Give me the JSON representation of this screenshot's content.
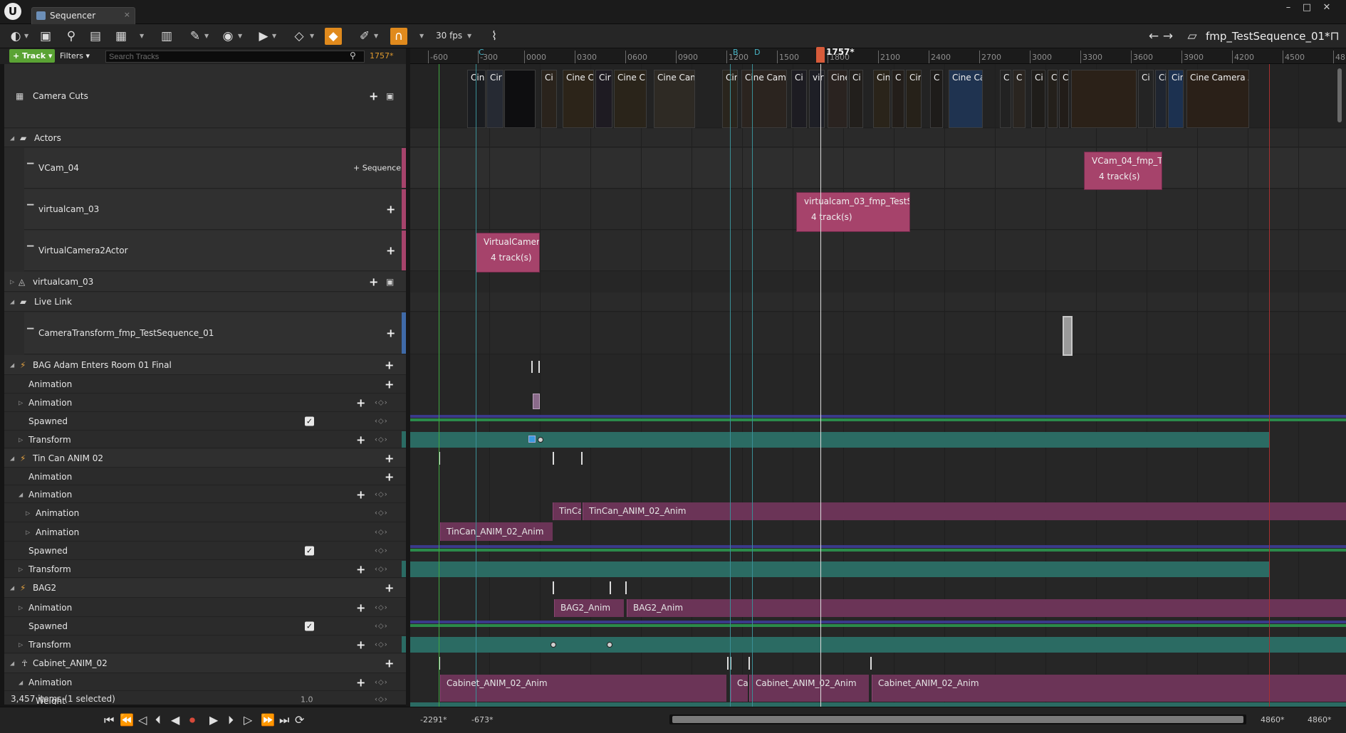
{
  "tab": {
    "title": "Sequencer",
    "close": "×"
  },
  "window_controls": {
    "minimize": "–",
    "maximize": "□",
    "close": "✕"
  },
  "toolbar": {
    "fps": "30 fps",
    "sequence_name": "fmp_TestSequence_01*",
    "nav_back": "←",
    "nav_forward": "→"
  },
  "outliner_header": {
    "track_button": "+ Track ▾",
    "filters_button": "Filters ▾",
    "search_placeholder": "Search Tracks",
    "current_frame": "1757*"
  },
  "tracks": [
    {
      "label": "Camera Cuts"
    },
    {
      "label": "Actors"
    },
    {
      "label": "VCam_04",
      "action": "Sequence"
    },
    {
      "label": "virtualcam_03"
    },
    {
      "label": "VirtualCamera2Actor"
    },
    {
      "label": "virtualcam_03"
    },
    {
      "label": "Live Link"
    },
    {
      "label": "CameraTransform_fmp_TestSequence_01"
    },
    {
      "label": "BAG Adam Enters Room 01 Final"
    },
    {
      "label": "Animation"
    },
    {
      "label": "Animation"
    },
    {
      "label": "Spawned"
    },
    {
      "label": "Transform"
    },
    {
      "label": "Tin Can ANIM 02"
    },
    {
      "label": "Animation"
    },
    {
      "label": "Animation"
    },
    {
      "label": "Animation"
    },
    {
      "label": "Animation"
    },
    {
      "label": "Spawned"
    },
    {
      "label": "Transform"
    },
    {
      "label": "BAG2"
    },
    {
      "label": "Animation"
    },
    {
      "label": "Spawned"
    },
    {
      "label": "Transform"
    },
    {
      "label": "Cabinet_ANIM_02"
    },
    {
      "label": "Animation"
    },
    {
      "label": "Weight",
      "value": "1.0"
    }
  ],
  "status": {
    "items": "3,457 items (1 selected)"
  },
  "ruler": {
    "ticks": [
      "-600",
      "-300",
      "0000",
      "0300",
      "0600",
      "0900",
      "1200",
      "1500",
      "1800",
      "2100",
      "2400",
      "2700",
      "3000",
      "3300",
      "3600",
      "3900",
      "4200",
      "4500",
      "48"
    ],
    "playhead": "1757*",
    "markers": [
      "C",
      "B",
      "D"
    ]
  },
  "camera_cuts": [
    "Cin",
    "Cir",
    "",
    "Ci",
    "Cine C",
    "Cir",
    "Cine C",
    "Cine Came",
    "Cin",
    "Cine Came",
    "Ci",
    "virt",
    "Cine",
    "Ci",
    "Cin",
    "C",
    "Cir",
    "C",
    "Cine Ca",
    "C",
    "C",
    "Ci",
    "C",
    "C",
    "",
    "Ci",
    "Ci",
    "Cin",
    "Cine Camera A"
  ],
  "sections": {
    "vcam04": {
      "title": "VCam_04_fmp_Te",
      "sub": "4 track(s)"
    },
    "virtualcam03": {
      "title": "virtualcam_03_fmp_TestSec",
      "sub": "4 track(s)"
    },
    "vcam2": {
      "title": "VirtualCamera",
      "sub": "4 track(s)"
    }
  },
  "anims": {
    "tincan_a": "TinCa",
    "tincan_b": "TinCan_ANIM_02_Anim",
    "tincan_c": "TinCan_ANIM_02_Anim",
    "bag2_a": "BAG2_Anim",
    "bag2_b": "BAG2_Anim",
    "cab_a": "Cabinet_ANIM_02_Anim",
    "cab_b": "Cab",
    "cab_c": "Cabinet_ANIM_02_Anim",
    "cab_d": "Cabinet_ANIM_02_Anim"
  },
  "bottom": {
    "range_start": "-2291*",
    "range_start2": "-673*",
    "range_end": "4860*",
    "range_end2": "4860*"
  },
  "colors": {
    "accent_orange": "#e08a1d",
    "track_green": "#5aa334",
    "section_pink": "#a6436b",
    "transform_teal": "#2b6b63",
    "playhead": "#d75b3a"
  }
}
